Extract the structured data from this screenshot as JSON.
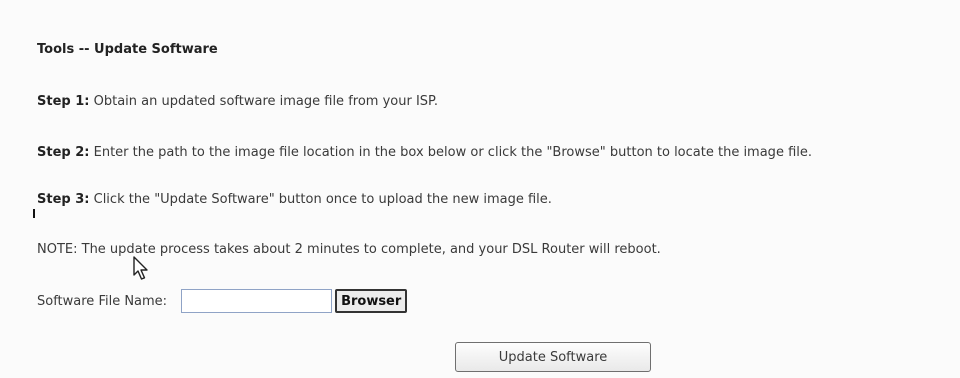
{
  "page": {
    "title": "Tools -- Update Software"
  },
  "steps": [
    {
      "label": "Step 1:",
      "text": " Obtain an updated software image file from your ISP."
    },
    {
      "label": "Step 2:",
      "text": " Enter the path to the image file location in the box below or click the \"Browse\" button to locate the image file."
    },
    {
      "label": "Step 3:",
      "text": " Click the \"Update Software\" button once to upload the new image file."
    }
  ],
  "note": "NOTE: The update process takes about 2 minutes to complete, and your DSL Router will reboot.",
  "file_field": {
    "label": "Software File Name:",
    "value": "",
    "browse_label": "Browser"
  },
  "update_button": {
    "label": "Update Software"
  },
  "icons": {
    "cursor": "mouse-pointer-icon"
  },
  "colors": {
    "background": "#fbfbfb",
    "input_border": "#8fa3c6",
    "text": "#3a3a3a"
  }
}
